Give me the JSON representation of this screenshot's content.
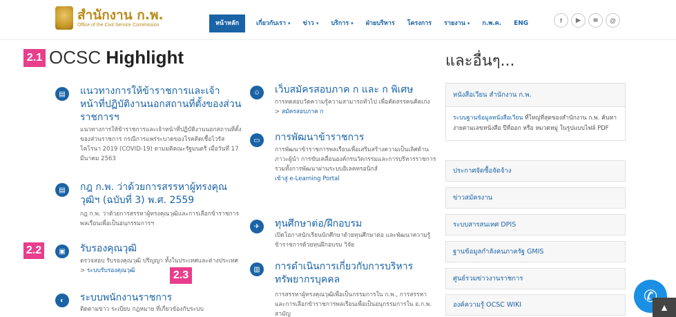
{
  "header": {
    "logo_main": "สำนักงาน ก.พ.",
    "logo_sub": "Office of the Civil Service Commission",
    "nav": [
      {
        "label": "หน้าหลัก",
        "caret": false,
        "active": true
      },
      {
        "label": "เกี่ยวกับเรา",
        "caret": true
      },
      {
        "label": "ข่าว",
        "caret": true
      },
      {
        "label": "บริการ",
        "caret": true
      },
      {
        "label": "ฝ่ายบริหาร",
        "caret": false
      },
      {
        "label": "โครงการ",
        "caret": false
      },
      {
        "label": "รายงาน",
        "caret": true
      },
      {
        "label": "ก.พ.ค.",
        "caret": false
      },
      {
        "label": "ENG",
        "caret": false
      }
    ],
    "social": [
      {
        "icon": "facebook-icon",
        "glyph": "f"
      },
      {
        "icon": "youtube-icon",
        "glyph": "▶"
      },
      {
        "icon": "rss-icon",
        "glyph": "≋"
      },
      {
        "icon": "email-icon",
        "glyph": "@"
      }
    ]
  },
  "badges": {
    "b21": "2.1",
    "b22": "2.2",
    "b23": "2.3"
  },
  "highlight": {
    "title_prefix": "OCSC",
    "title_bold": "Highlight",
    "left_items": [
      {
        "icon": "document-icon",
        "title": "แนวทางการให้ข้าราชการและเจ้าหน้าที่ปฏิบัติงานนอกสถานที่ตั้งของส่วนราชการฯ",
        "desc": "แนวทางการให้ข้าราชการและเจ้าหน้าที่ปฏิบัติงานนอกสถานที่ตั้งของส่วนราชการ กรณีการแพร่ระบาดของโรคติดเชื้อไวรัสโคโรนา 2019 (COVID-19) ตามมติคณะรัฐมนตรี เมื่อวันที่ 17 มีนาคม 2563"
      },
      {
        "icon": "document-icon",
        "title": "กฎ ก.พ. ว่าด้วยการสรรหาผู้ทรงคุณวุฒิฯ (ฉบับที่ 3) พ.ศ. 2559",
        "desc": "กฎ ก.พ. ว่าด้วยการสรรหาผู้ทรงคุณวุฒิและการเลือกข้าราชการพลเรือนเพื่อเป็นอนุกรรมการฯ"
      },
      {
        "icon": "certificate-icon",
        "title": "รับรองคุณวุฒิ",
        "desc": "ตรวจสอบ รับรองคุณวุฒิ ปริญญา ทั้งในประเทศและต่างประเทศ >",
        "link": "ระบบรับรองคุณวุฒิ"
      },
      {
        "icon": "system-icon",
        "title": "ระบบพนักงานราชการ",
        "desc": "ติดตามข่าว ระเบียบ กฎหมาย ที่เกี่ยวข้องกับระบบ"
      }
    ],
    "mid_items": [
      {
        "icon": "users-icon",
        "title": "เว็บสมัครสอบภาค ก และ ก พิเศษ",
        "desc": "การทดสอบวัดความรู้ความสามารถทั่วไป เพื่อคัดสรรคนคิดเก่ง >",
        "link": "สมัครสอบภาค ก"
      },
      {
        "icon": "elearning-icon",
        "title": "การพัฒนาข้าราชการ",
        "desc": "การพัฒนาข้าราชการพลเรือนเพื่อเสริมสร้างความเป็นเลิศด้านภาวะผู้นำ การขับเคลื่อนองค์กรนวัตกรรมและการบริหารราชการ รวมทั้งการพัฒนาผ่านระบบอิเลคทรอนิกส์",
        "link": "เข้าสู่ e-Learning Portal"
      },
      {
        "icon": "plane-icon",
        "title": "ทุนศึกษาต่อ/ฝึกอบรม",
        "desc": "เปิดโอกาสนักเรียนนักศึกษาด้วยทุนศึกษาต่อ และพัฒนาความรู้ข้าราชการด้วยทุนฝึกอบรม วิจัย"
      },
      {
        "icon": "chart-icon",
        "title": "การดำเนินการเกี่ยวกับการบริหารทรัพยากรบุคคล",
        "desc": "การสรรหาผู้ทรงคุณวุฒิเพื่อเป็นกรรมการใน ก.พ., การสรรหาและการเลือกข้าราชการพลเรือนเพื่อเป็นอนุกรรมการใน อ.ก.พ. สามัญ"
      }
    ]
  },
  "sidebar": {
    "title": "และอื่นๆ...",
    "panel_title": "หนังสือเวียน สำนักงาน ก.พ.",
    "panel_link": "ระบบฐานข้อมูลหนังสือเวียน",
    "panel_desc": "ที่ใหญ่ที่สุดของสำนักงาน ก.พ. ค้นหาง่ายตามเลขหนังสือ ปีที่ออก หรือ หมวดหมู่ ในรูปแบบไฟล์ PDF",
    "links": [
      "ประกาศจัดซื้อจัดจ้าง",
      "ข่าวสมัครงาน",
      "ระบบสารสนเทศ DPIS",
      "ฐานข้อมูลกำลังคนภาครัฐ GMIS",
      "ศูนย์รวมข่าวงานราชการ",
      "องค์ความรู้ OCSC WIKI"
    ]
  },
  "colors": {
    "accent": "#1a63a6",
    "badge": "#e83e8c",
    "brand_gold": "#b98b1a"
  }
}
